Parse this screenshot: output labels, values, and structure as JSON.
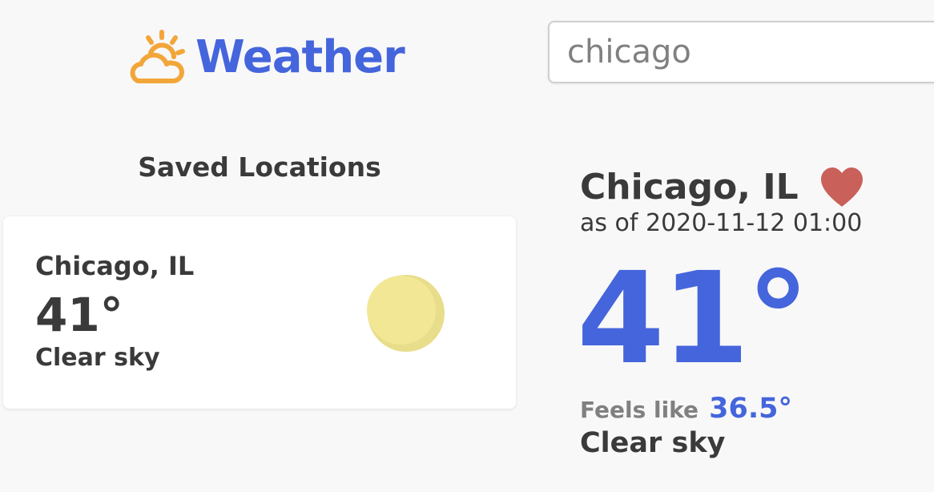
{
  "colors": {
    "brand": "#4565dc",
    "logo_icon": "#f2a63a",
    "heart": "#c9605a",
    "sun": "#f2e795",
    "text_dark": "#3a3a3a",
    "text_muted": "#808080",
    "background": "#f8f8f8"
  },
  "header": {
    "logo_icon": "sun-behind-cloud-icon",
    "logo_text": "Weather"
  },
  "search": {
    "placeholder": "chicago",
    "value": ""
  },
  "saved": {
    "heading": "Saved Locations",
    "items": [
      {
        "location": "Chicago, IL",
        "temp": "41°",
        "condition": "Clear sky",
        "icon": "sun-icon"
      }
    ]
  },
  "current": {
    "location": "Chicago, IL",
    "favorite_icon": "heart-icon",
    "as_of": "as of 2020-11-12 01:00",
    "temp": "41°",
    "feels_label": "Feels like",
    "feels_value": "36.5°",
    "condition": "Clear sky"
  }
}
